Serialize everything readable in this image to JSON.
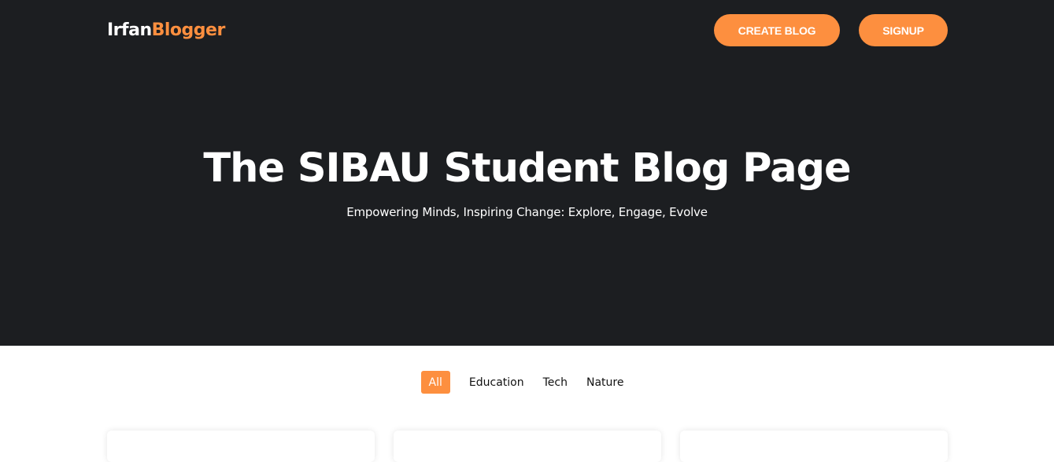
{
  "header": {
    "logo_part1": "Irfan",
    "logo_part2": "Blogger",
    "create_blog_label": "CREATE BLOG",
    "signup_label": "SIGNUP"
  },
  "hero": {
    "title": "The SIBAU Student Blog Page",
    "subtitle": "Empowering Minds, Inspiring Change: Explore, Engage, Evolve"
  },
  "filters": {
    "items": [
      "All",
      "Education",
      "Tech",
      "Nature"
    ],
    "active": "All"
  },
  "colors": {
    "accent": "#fd8f3f",
    "hero_bg": "#1c1e21",
    "page_bg": "#ffffff"
  }
}
